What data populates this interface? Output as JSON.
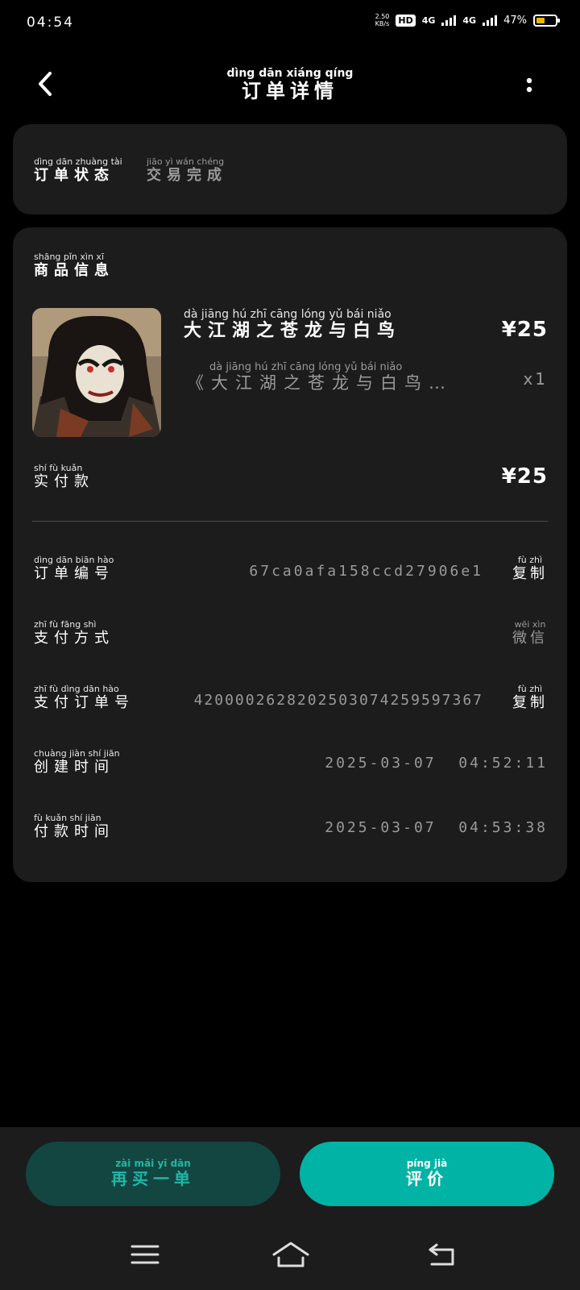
{
  "status_bar": {
    "time": "04:54",
    "speed": "2.50",
    "speed_unit": "KB/s",
    "hd": "HD",
    "net1": "4G",
    "net2": "4G",
    "battery": "47%"
  },
  "header": {
    "title_pinyin": "dìng dān xiáng qíng",
    "title": "订单详情"
  },
  "status_card": {
    "label_pinyin": "dìng dān zhuàng tài",
    "label": "订单状态",
    "value_pinyin": "jiāo  yì  wán chéng",
    "value": "交易完成"
  },
  "product_card": {
    "section_pinyin": "shāng pǐn  xìn  xī",
    "section": "商品信息",
    "product_name_pinyin": "dà  jiāng  hú   zhī  cāng lóng  yǔ   bái  niǎo",
    "product_name": "大江湖之苍龙与白鸟",
    "price": "¥25",
    "subtitle_pinyin": "dà  jiāng  hú   zhī  cāng lóng  yǔ   bái  niǎo",
    "subtitle": "《大江湖之苍龙与白鸟…",
    "quantity": "x1",
    "paid_label_pinyin": "shí   fù  kuǎn",
    "paid_label": "实付款",
    "paid_value": "¥25"
  },
  "details": {
    "order_no_pinyin": "dìng dān biān hào",
    "order_no_label": "订单编号",
    "order_no": "67ca0afa158ccd27906e1",
    "copy_pinyin": "fù   zhì",
    "copy": "复制",
    "pay_method_pinyin": "zhī   fù  fāng  shì",
    "pay_method_label": "支付方式",
    "pay_method_value_pinyin": "wēi  xìn",
    "pay_method_value": "微信",
    "pay_order_pinyin": "zhī   fù  dìng dān  hào",
    "pay_order_label": "支付订单号",
    "pay_order_no": "4200002628202503074259597367",
    "created_pinyin": "chuàng jiàn  shí  jiān",
    "created_label": "创建时间",
    "created_value": "2025-03-07  04:52:11",
    "paid_time_pinyin": "fù  kuǎn  shí  jiān",
    "paid_time_label": "付款时间",
    "paid_time_value": "2025-03-07  04:53:38"
  },
  "actions": {
    "rebuy_pinyin": "zài  mǎi  yī  dān",
    "rebuy": "再买一单",
    "review_pinyin": "píng  jià",
    "review": "评价"
  },
  "nav": {
    "menu_icon": "menu-icon",
    "home_icon": "home-icon",
    "back_icon": "back-icon"
  },
  "colors": {
    "accent": "#00b3a4",
    "rebuy_bg": "#134541",
    "card": "#1c1c1c",
    "battery": "#f0b400"
  }
}
